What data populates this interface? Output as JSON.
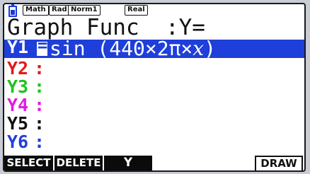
{
  "statusbar": {
    "badges": [
      "Math",
      "Rad",
      "Norm1",
      "Real"
    ]
  },
  "title": "Graph Func  :Y=",
  "functions": [
    {
      "label": "Y1",
      "equals": "=",
      "expression_prefix": "sin (440×2π×",
      "variable": "x",
      "expression_suffix": ")",
      "color": "#1e3fd9",
      "selected": true
    },
    {
      "label": "Y2",
      "colon": ":",
      "color": "#e01a1a"
    },
    {
      "label": "Y3",
      "colon": ":",
      "color": "#1ec21e"
    },
    {
      "label": "Y4",
      "colon": ":",
      "color": "#e41ae4"
    },
    {
      "label": "Y5",
      "colon": ":",
      "color": "#111111"
    },
    {
      "label": "Y6",
      "colon": ":",
      "color": "#1e3fd9"
    }
  ],
  "fkeys": {
    "f1": "SELECT",
    "f2": "DELETE",
    "f3": "Y",
    "f6": "DRAW"
  }
}
